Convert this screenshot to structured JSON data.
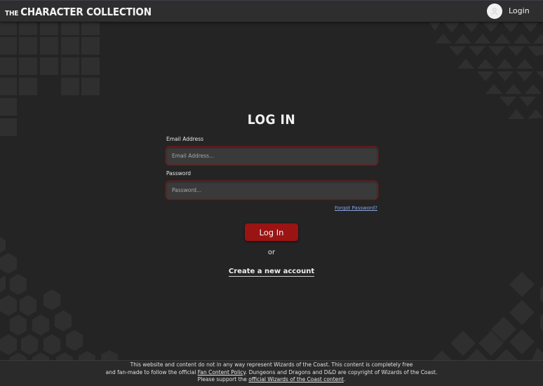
{
  "header": {
    "brand_prefix": "THE",
    "brand_name": "CHARACTER COLLECTION",
    "login_label": "Login",
    "avatar_icon": "user-icon"
  },
  "form": {
    "title": "LOG IN",
    "email_label": "Email Address",
    "email_placeholder": "Email Address...",
    "password_label": "Password",
    "password_placeholder": "Password...",
    "forgot_label": "Forgot Password?",
    "submit_label": "Log In",
    "or_label": "or",
    "create_account_label": "Create a new account"
  },
  "footer": {
    "line1": "This website and content do not in any way represent Wizards of the Coast. This content is completely free",
    "line2_pre": "and fan-made to follow the official ",
    "line2_link": "Fan Content Policy",
    "line2_post": ". Dungeons and Dragons and D&D are copyright of Wizards of the Coast.",
    "line3_pre": "Please support the ",
    "line3_link": "official Wizards of the Coast content",
    "line3_post": "."
  },
  "colors": {
    "background": "#242424",
    "accent": "#9a1414",
    "field_border": "#7d1b1b",
    "link": "#86a6e0"
  }
}
